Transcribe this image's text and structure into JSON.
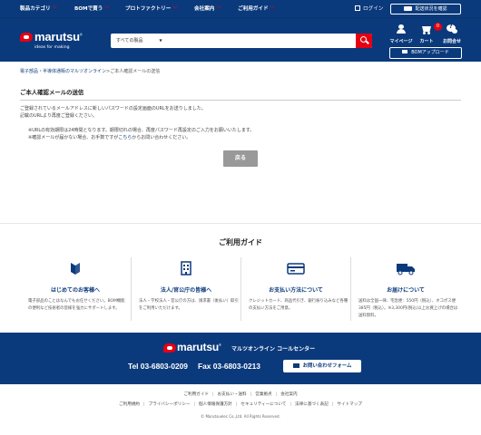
{
  "topnav": {
    "items": [
      "製品カテゴリ",
      "BOMで買う",
      "プロトファクトリー",
      "会社案内",
      "ご利用ガイド"
    ],
    "login": "ログイン",
    "shipping_button": "配送状況を確認"
  },
  "header": {
    "logo_text": "marutsu",
    "registered": "®",
    "tagline": "ideas for making",
    "search_category": "すべての製品",
    "search_placeholder": "",
    "icons": {
      "mypage": "マイページ",
      "cart": "カート",
      "cart_count": "0",
      "contact": "お問合せ"
    },
    "bom_upload": "BOMアップロード"
  },
  "breadcrumb": {
    "home": "電子部品・半導体通販のマルツオンライン",
    "separator": ">",
    "current": "ご本人確認メールの送信"
  },
  "content": {
    "title": "ご本人確認メールの送信",
    "message1": "ご登録されているメールアドレスに新しいパスワードの設定画面のURLをお送りしました。",
    "message2": "記載のURLより再度ご登録ください。",
    "note1": "※URLの有効期限は24時間となります。期限切れの場合、再度パスワード再設定のご入力をお願いいたします。",
    "note2_pre": "※確認メールが届かない場合、お手数ですが",
    "note2_link": "こちら",
    "note2_post": "からお問い合わせください。",
    "back_button": "戻る"
  },
  "guide": {
    "title": "ご利用ガイド",
    "columns": [
      {
        "icon": "beginner-mark-icon",
        "name": "はじめてのお客様へ",
        "desc": "電子部品のことはなんでもお任せください。BOM機能の便利など技術者の皆様を強力にサポートします。"
      },
      {
        "icon": "building-icon",
        "name": "法人/官公庁の皆様へ",
        "desc": "法人・学校法人・官公庁の方は、請求書（後払い）取引をご利用いただけます。"
      },
      {
        "icon": "credit-card-icon",
        "name": "お支払い方法について",
        "desc": "クレジットカード、商品代引き、銀行振り込みなど各種の支払い方法をご用意。"
      },
      {
        "icon": "truck-icon",
        "name": "お届けについて",
        "desc": "送料は全国一律、宅急便：550円（税込）、ネコポス便385円（税込）。※3,300円(税込)以上お買上げの場合は送料無料。"
      }
    ]
  },
  "footer": {
    "logo_text": "marutsu",
    "registered": "®",
    "call_center": "マルツオンライン コールセンター",
    "tel": "Tel 03-6803-0209",
    "fax": "Fax 03-6803-0213",
    "form_button": "お問い合わせフォーム",
    "links_row1": [
      "ご利用ガイド",
      "お支払い・送料",
      "営業拠点",
      "会社案内"
    ],
    "links_row2": [
      "ご利用規約",
      "プライバシーポリシー",
      "個人情報保護方針",
      "セキュリティーについて",
      "法律に基づく表記",
      "サイトマップ"
    ],
    "copyright": "© Marutsuelec Co.,Ltd. All Rights Reserved."
  },
  "colors": {
    "brand_navy": "#0b3a7c",
    "accent_red": "#e60012",
    "button_gray": "#999999"
  }
}
